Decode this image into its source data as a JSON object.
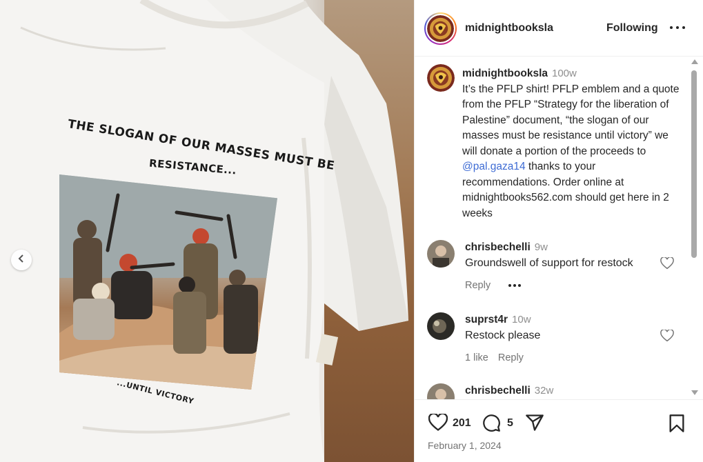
{
  "photo": {
    "slogan_line1": "THE SLOGAN OF OUR MASSES MUST BE",
    "slogan_line2": "RESISTANCE...",
    "slogan_line3": "...UNTIL VICTORY",
    "prev_icon": "chevron-left-icon"
  },
  "post": {
    "username": "midnightbooksla",
    "follow_label": "Following",
    "more_icon": "more-options-icon",
    "caption": {
      "username": "midnightbooksla",
      "time": "100w",
      "text_before_mention": "It’s the PFLP shirt! PFLP emblem and a quote from the PFLP “Strategy for the liberation of Palestine” document, “the slogan of our masses must be resistance until victory” we will donate a portion of the proceeds to ",
      "mention": "@pal.gaza14",
      "text_after_mention": " thanks to your recommendations. Order online at midnightbooks562.com should get here in 2 weeks"
    },
    "comments": [
      {
        "username": "chrisbechelli",
        "time": "9w",
        "text": "Groundswell of support for restock",
        "reply_label": "Reply",
        "likes": ""
      },
      {
        "username": "suprst4r",
        "time": "10w",
        "text": "Restock please",
        "reply_label": "Reply",
        "likes": "1 like"
      },
      {
        "username": "chrisbechelli",
        "time": "32w",
        "text": "",
        "reply_label": "",
        "likes": ""
      }
    ],
    "likes_count": "201",
    "comments_count": "5",
    "date": "February 1, 2024",
    "colors": {
      "mention": "#3d6bd4",
      "secondary_text": "#737373",
      "primary_text": "#262626"
    }
  }
}
